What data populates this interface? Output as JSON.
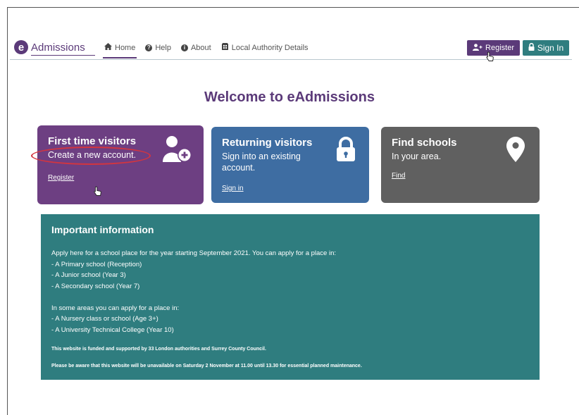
{
  "nav": {
    "logo_letter": "e",
    "logo_text": "Admissions",
    "links": [
      {
        "label": "Home",
        "icon": "home-icon"
      },
      {
        "label": "Help",
        "icon": "question-icon"
      },
      {
        "label": "About",
        "icon": "info-icon"
      },
      {
        "label": "Local Authority Details",
        "icon": "building-icon"
      }
    ],
    "register_label": "Register",
    "signin_label": "Sign In"
  },
  "page": {
    "title": "Welcome to eAdmissions"
  },
  "cards": {
    "first": {
      "title": "First time visitors",
      "subtitle": "Create a new account.",
      "link": "Register",
      "icon": "user-add-icon",
      "color": "#6d3f82"
    },
    "returning": {
      "title": "Returning visitors",
      "subtitle": "Sign into an existing account.",
      "link": "Sign in",
      "icon": "lock-icon",
      "color": "#3e6da2"
    },
    "find": {
      "title": "Find schools",
      "subtitle": "In your area.",
      "link": "Find",
      "icon": "map-pin-icon",
      "color": "#606060"
    }
  },
  "info": {
    "title": "Important information",
    "lines": [
      "Apply here for a school place for the year starting September 2021. You can apply for a place in:",
      "- A Primary school (Reception)",
      "- A Junior school (Year 3)",
      "- A Secondary school (Year 7)",
      "",
      "In some areas you can apply for a place in:",
      "- A Nursery class or school (Age 3+)",
      "- A University Technical College (Year 10)"
    ],
    "funding_note": "This website is funded and supported by 33 London authorities and Surrey County Council.",
    "maintenance_note": "Please be aware that this website will be unavailable on Saturday 2 November at 11.00 until 13.30 for essential planned maintenance.",
    "color": "#2f7d7f"
  },
  "colors": {
    "brand": "#5b3a79",
    "teal": "#2f7d7f",
    "highlight": "#d3353f"
  }
}
